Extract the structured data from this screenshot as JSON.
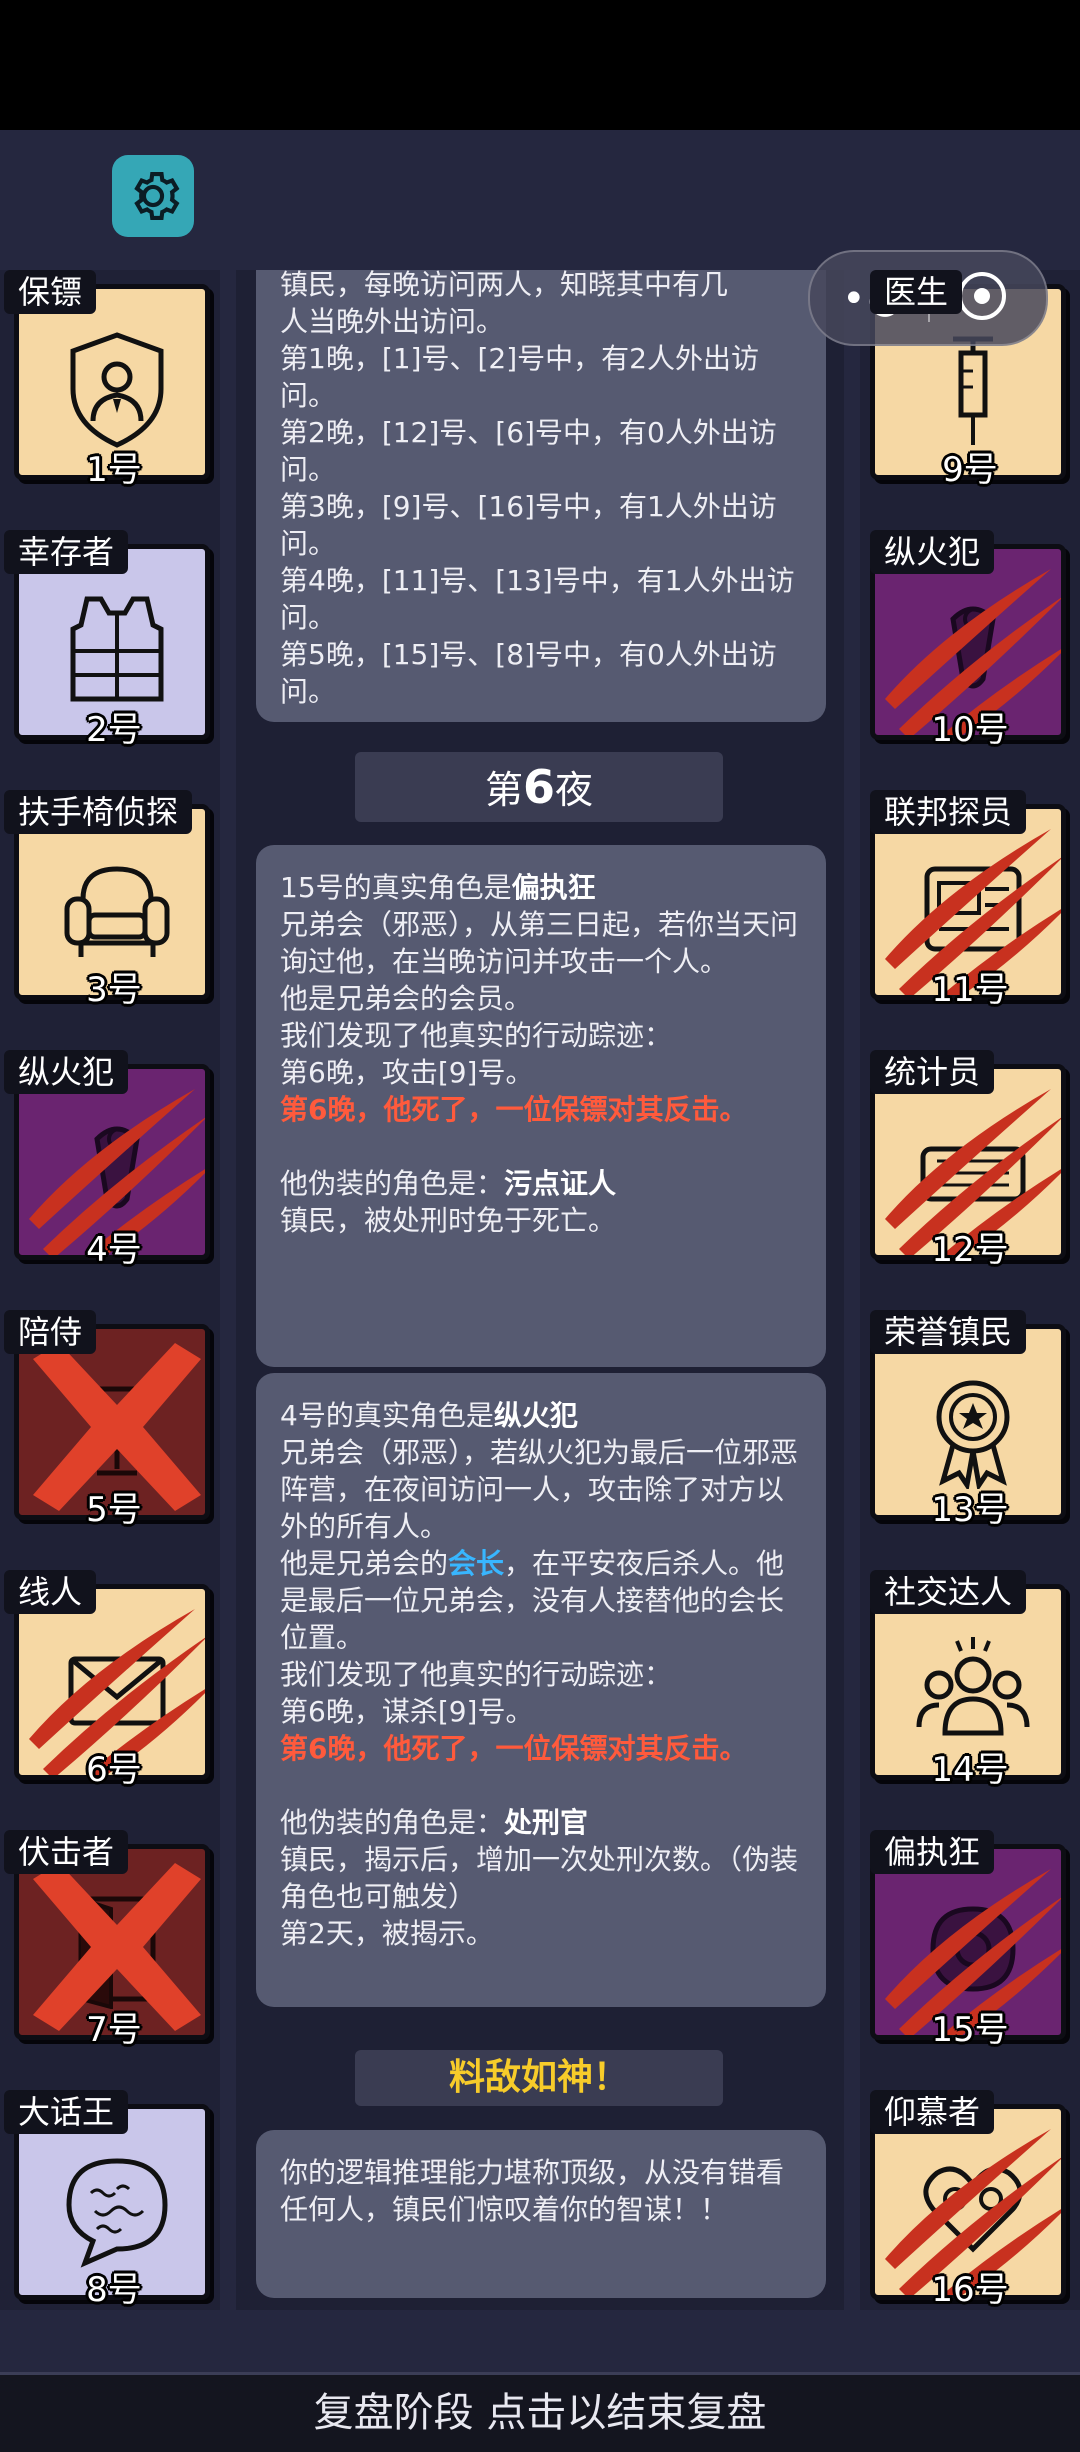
{
  "players_left": [
    {
      "num": "1号",
      "role": "保镖",
      "bg": "#f6d8a4",
      "icon": "bodyguard-icon",
      "state": "alive"
    },
    {
      "num": "2号",
      "role": "幸存者",
      "bg": "#c9c6ea",
      "icon": "vest-icon",
      "state": "alive"
    },
    {
      "num": "3号",
      "role": "扶手椅侦探",
      "bg": "#f6d8a4",
      "icon": "armchair-icon",
      "state": "alive"
    },
    {
      "num": "4号",
      "role": "纵火犯",
      "bg": "#6a2470",
      "icon": "arsonist-icon",
      "state": "dead"
    },
    {
      "num": "5号",
      "role": "陪侍",
      "bg": "#6d2222",
      "icon": "escort-icon",
      "state": "executed"
    },
    {
      "num": "6号",
      "role": "线人",
      "bg": "#f6d8a4",
      "icon": "informant-icon",
      "state": "dead"
    },
    {
      "num": "7号",
      "role": "伏击者",
      "bg": "#6d2222",
      "icon": "ambusher-icon",
      "state": "executed"
    },
    {
      "num": "8号",
      "role": "大话王",
      "bg": "#c9c6ea",
      "icon": "speech-bubble-icon",
      "state": "alive"
    }
  ],
  "players_right": [
    {
      "num": "9号",
      "role": "医生",
      "bg": "#f6d8a4",
      "icon": "syringe-icon",
      "state": "alive"
    },
    {
      "num": "10号",
      "role": "纵火犯",
      "bg": "#6a2470",
      "icon": "arsonist-icon",
      "state": "dead"
    },
    {
      "num": "11号",
      "role": "联邦探员",
      "bg": "#f6d8a4",
      "icon": "agent-badge-icon",
      "state": "dead"
    },
    {
      "num": "12号",
      "role": "统计员",
      "bg": "#f6d8a4",
      "icon": "statistician-icon",
      "state": "dead"
    },
    {
      "num": "13号",
      "role": "荣誉镇民",
      "bg": "#f6d8a4",
      "icon": "medal-icon",
      "state": "alive"
    },
    {
      "num": "14号",
      "role": "社交达人",
      "bg": "#f6d8a4",
      "icon": "crowd-icon",
      "state": "alive"
    },
    {
      "num": "15号",
      "role": "偏执狂",
      "bg": "#6a2470",
      "icon": "paranoid-icon",
      "state": "dead"
    },
    {
      "num": "16号",
      "role": "仰慕者",
      "bg": "#f6d8a4",
      "icon": "admirer-icon",
      "state": "dead"
    }
  ],
  "log": {
    "msg1": {
      "cut_line1": "镇民，每晚访问两人，知晓其中有几",
      "cut_line2": "人当晚外出访问。",
      "n1": "第1晚，[1]号、[2]号中，有2人外出访问。",
      "n2": "第2晚，[12]号、[6]号中，有0人外出访问。",
      "n3": "第3晚，[9]号、[16]号中，有1人外出访问。",
      "n4": "第4晚，[11]号、[13]号中，有1人外出访问。",
      "n5": "第5晚，[15]号、[8]号中，有0人外出访问。"
    },
    "night_prefix": "第",
    "night_number": "6",
    "night_suffix": "夜",
    "msg2": {
      "intro": "15号的真实角色是",
      "role": "偏执狂",
      "desc": "兄弟会（邪恶），从第三日起，若你当天问询过他，在当晚访问并攻击一个人。",
      "member": "他是兄弟会的会员。",
      "trace_title": "我们发现了他真实的行动踪迹：",
      "trace": "第6晚，攻击[9]号。",
      "death": "第6晚，他死了，一位保镖对其反击。",
      "disguise_intro": "他伪装的角色是：",
      "disguise_role": "污点证人",
      "disguise_desc": "镇民，被处刑时免于死亡。"
    },
    "msg3": {
      "intro": "4号的真实角色是",
      "role": "纵火犯",
      "desc": "兄弟会（邪恶），若纵火犯为最后一位邪恶阵营，在夜间访问一人，攻击除了对方以外的所有人。",
      "member_pre": "他是兄弟会的",
      "member_rank": "会长",
      "member_post": "，在平安夜后杀人。他是最后一位兄弟会，没有人接替他的会长位置。",
      "trace_title": "我们发现了他真实的行动踪迹：",
      "trace": "第6晚，谋杀[9]号。",
      "death": "第6晚，他死了，一位保镖对其反击。",
      "disguise_intro": "他伪装的角色是：",
      "disguise_role": "处刑官",
      "disguise_desc": "镇民，揭示后，增加一次处刑次数。（伪装角色也可触发）",
      "revealed": "第2天，被揭示。"
    },
    "banner": "料敌如神！",
    "final": "你的逻辑推理能力堪称顶级，从没有错看任何人，镇民们惊叹着你的智谋！！"
  },
  "bottom_bar": "复盘阶段 点击以结束复盘"
}
